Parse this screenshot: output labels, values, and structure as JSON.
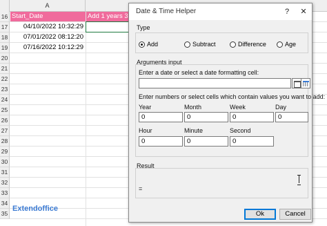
{
  "sheet": {
    "columns": [
      "A"
    ],
    "rows": [
      "16",
      "17",
      "18",
      "19",
      "20",
      "21",
      "22",
      "23",
      "24",
      "25",
      "26",
      "27",
      "28",
      "29",
      "30",
      "31",
      "32",
      "33",
      "34",
      "35"
    ],
    "header_cells": {
      "a": "Start_Date",
      "b": "Add 1 years 3"
    },
    "data_cells": [
      "04/10/2022 10:32:29",
      "07/01/2022 08:12:20",
      "07/16/2022 10:12:29"
    ],
    "brand": "Extendoffice",
    "header_color": "#f06b9c",
    "brand_color": "#3c7bd3"
  },
  "dialog": {
    "title": "Date & Time Helper",
    "titlebar_buttons": {
      "help": "?",
      "close": "✕"
    },
    "type_group_label": "Type",
    "types": [
      {
        "label": "Add",
        "selected": true
      },
      {
        "label": "Subtract",
        "selected": false
      },
      {
        "label": "Difference",
        "selected": false
      },
      {
        "label": "Age",
        "selected": false
      }
    ],
    "args_group_label": "Arguments input",
    "date_prompt": "Enter a date or select a date formatting cell:",
    "date_value": "",
    "numbers_prompt": "Enter numbers or select cells which contain values you want to add:",
    "info_icon_glyph": "i",
    "fields": [
      {
        "label": "Year",
        "value": "0"
      },
      {
        "label": "Month",
        "value": "0"
      },
      {
        "label": "Week",
        "value": "0"
      },
      {
        "label": "Day",
        "value": "0"
      },
      {
        "label": "Hour",
        "value": "0"
      },
      {
        "label": "Minute",
        "value": "0"
      },
      {
        "label": "Second",
        "value": "0"
      }
    ],
    "result_label": "Result",
    "result_value": "=",
    "ok_label": "Ok",
    "cancel_label": "Cancel",
    "accent_color": "#0078d7"
  }
}
